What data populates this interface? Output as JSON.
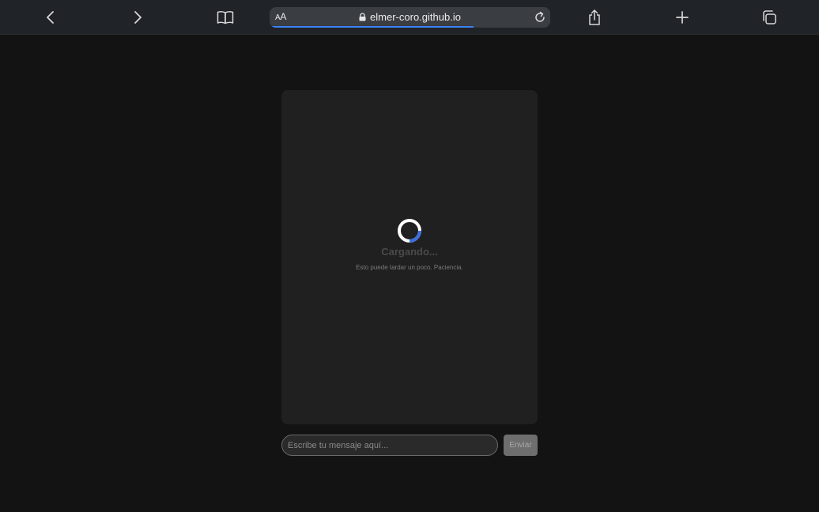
{
  "browser": {
    "url": "elmer-coro.github.io",
    "reader_label_big": "A",
    "reader_label_small": "A",
    "load_progress": 0.72,
    "icons": {
      "back": "chevron-left-icon",
      "forward": "chevron-right-icon",
      "bookmarks": "open-book-icon",
      "lock": "lock-icon",
      "reload": "reload-icon",
      "share": "share-icon",
      "new_tab": "plus-icon",
      "tabs": "tabs-overview-icon"
    }
  },
  "chat": {
    "loading_title": "Cargando...",
    "loading_subtitle": "Esto puede tardar un poco. Paciencia.",
    "input_placeholder": "Escribe tu mensaje aquí...",
    "send_label": "Enviar"
  },
  "colors": {
    "page_background": "#131313",
    "card_background": "#202020",
    "spinner_track": "#ffffff",
    "spinner_accent": "#3b6fe0",
    "url_progress": "#3b82f6"
  }
}
